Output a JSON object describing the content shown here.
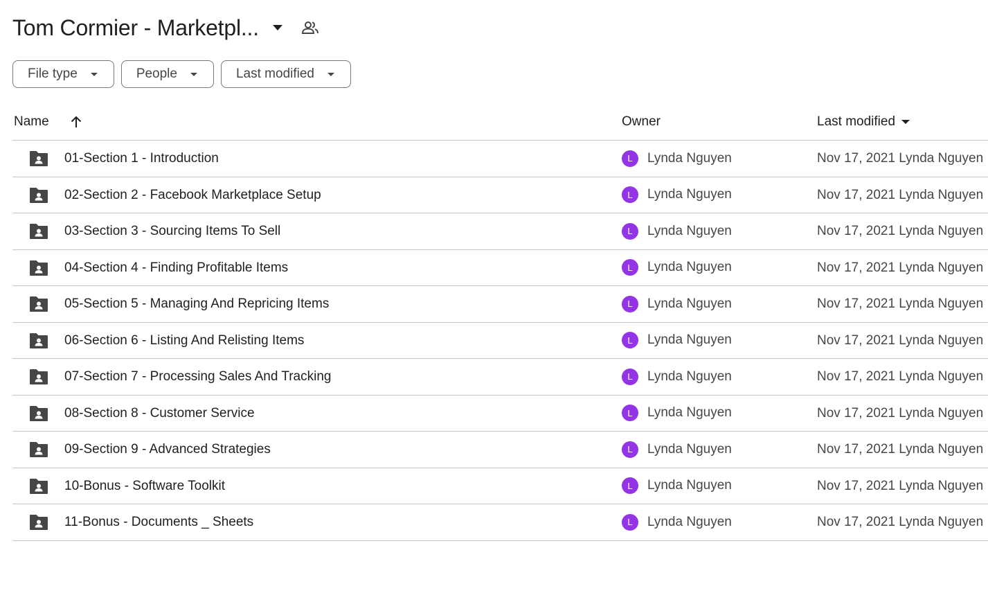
{
  "header": {
    "title": "Tom Cormier - Marketpl...",
    "title_caret_icon": "arrow-drop-down-icon",
    "shared_icon": "people-icon"
  },
  "filters": [
    {
      "label": "File type",
      "icon": "arrow-drop-down-icon"
    },
    {
      "label": "People",
      "icon": "arrow-drop-down-icon"
    },
    {
      "label": "Last modified",
      "icon": "arrow-drop-down-icon"
    }
  ],
  "table": {
    "columns": {
      "name": "Name",
      "owner": "Owner",
      "last_modified": "Last modified"
    },
    "sort": {
      "name_icon": "arrow-upward-icon",
      "modified_icon": "arrow-drop-down-icon"
    },
    "avatar_color": "#9334e6",
    "rows": [
      {
        "name": "01-Section 1 - Introduction",
        "avatar": "L",
        "owner": "Lynda Nguyen",
        "modified": "Nov 17, 2021 Lynda Nguyen"
      },
      {
        "name": "02-Section 2 - Facebook Marketplace Setup",
        "avatar": "L",
        "owner": "Lynda Nguyen",
        "modified": "Nov 17, 2021 Lynda Nguyen"
      },
      {
        "name": "03-Section 3 - Sourcing Items To Sell",
        "avatar": "L",
        "owner": "Lynda Nguyen",
        "modified": "Nov 17, 2021 Lynda Nguyen"
      },
      {
        "name": "04-Section 4 - Finding Profitable Items",
        "avatar": "L",
        "owner": "Lynda Nguyen",
        "modified": "Nov 17, 2021 Lynda Nguyen"
      },
      {
        "name": "05-Section 5 - Managing And Repricing Items",
        "avatar": "L",
        "owner": "Lynda Nguyen",
        "modified": "Nov 17, 2021 Lynda Nguyen"
      },
      {
        "name": "06-Section 6 - Listing And Relisting Items",
        "avatar": "L",
        "owner": "Lynda Nguyen",
        "modified": "Nov 17, 2021 Lynda Nguyen"
      },
      {
        "name": "07-Section 7 - Processing Sales And Tracking",
        "avatar": "L",
        "owner": "Lynda Nguyen",
        "modified": "Nov 17, 2021 Lynda Nguyen"
      },
      {
        "name": "08-Section 8 - Customer Service",
        "avatar": "L",
        "owner": "Lynda Nguyen",
        "modified": "Nov 17, 2021 Lynda Nguyen"
      },
      {
        "name": "09-Section 9 - Advanced Strategies",
        "avatar": "L",
        "owner": "Lynda Nguyen",
        "modified": "Nov 17, 2021 Lynda Nguyen"
      },
      {
        "name": "10-Bonus - Software Toolkit",
        "avatar": "L",
        "owner": "Lynda Nguyen",
        "modified": "Nov 17, 2021 Lynda Nguyen"
      },
      {
        "name": "11-Bonus - Documents _ Sheets",
        "avatar": "L",
        "owner": "Lynda Nguyen",
        "modified": "Nov 17, 2021 Lynda Nguyen"
      }
    ]
  }
}
